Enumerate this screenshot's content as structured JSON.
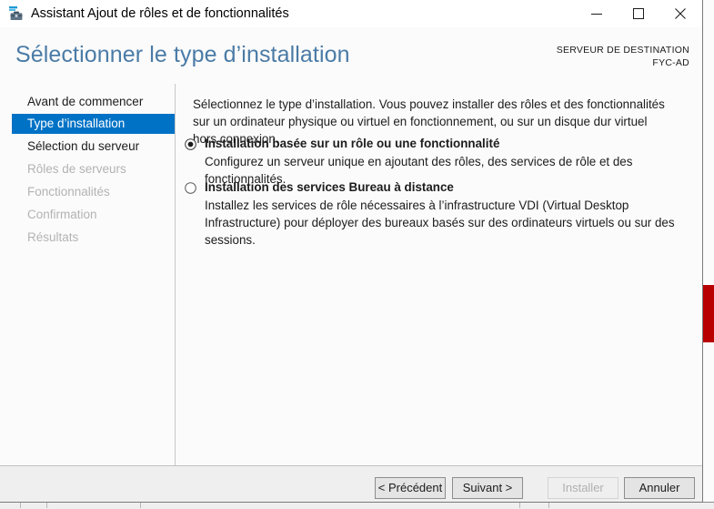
{
  "window": {
    "title": "Assistant Ajout de rôles et de fonctionnalités",
    "icon": "toolbox-icon",
    "controls": {
      "minimize": "minimize-icon",
      "maximize": "maximize-icon",
      "close": "close-icon"
    }
  },
  "header": {
    "page_title": "Sélectionner le type d’installation",
    "destination_label": "SERVEUR DE DESTINATION",
    "destination_server": "FYC-AD",
    "title_color": "#4a7ba6"
  },
  "sidebar": {
    "selected_index": 1,
    "highlight_color": "#0072c6",
    "items": [
      {
        "label": "Avant de commencer",
        "state": "enabled"
      },
      {
        "label": "Type d’installation",
        "state": "selected"
      },
      {
        "label": "Sélection du serveur",
        "state": "enabled"
      },
      {
        "label": "Rôles de serveurs",
        "state": "disabled"
      },
      {
        "label": "Fonctionnalités",
        "state": "disabled"
      },
      {
        "label": "Confirmation",
        "state": "disabled"
      },
      {
        "label": "Résultats",
        "state": "disabled"
      }
    ]
  },
  "main": {
    "intro": "Sélectionnez le type d’installation. Vous pouvez installer des rôles et des fonctionnalités sur un ordinateur physique ou virtuel en fonctionnement, ou sur un disque dur virtuel hors connexion.",
    "options": [
      {
        "title": "Installation basée sur un rôle ou une fonctionnalité",
        "description": "Configurez un serveur unique en ajoutant des rôles, des services de rôle et des fonctionnalités.",
        "selected": true
      },
      {
        "title": "Installation des services Bureau à distance",
        "description": "Installez les services de rôle nécessaires à l’infrastructure VDI (Virtual Desktop Infrastructure) pour déployer des bureaux basés sur des ordinateurs virtuels ou sur des sessions.",
        "selected": false
      }
    ]
  },
  "footer": {
    "previous_label": "< Précédent",
    "next_label": "Suivant >",
    "install_label": "Installer",
    "cancel_label": "Annuler",
    "install_enabled": false
  },
  "background": {
    "red_bar_color": "#b90000"
  }
}
